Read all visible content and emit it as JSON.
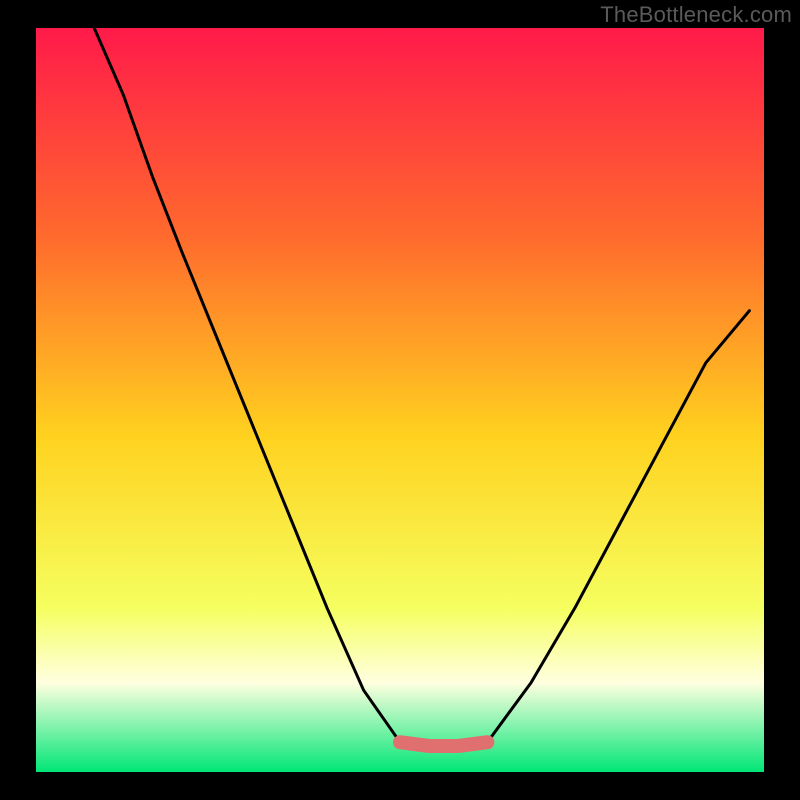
{
  "watermark": "TheBottleneck.com",
  "colors": {
    "background": "#000000",
    "gradient_top": "#ff1a4a",
    "gradient_upper_mid": "#ff6a2d",
    "gradient_mid": "#ffd21f",
    "gradient_lower_mid": "#f5ff60",
    "gradient_band_pale": "#ffffe0",
    "gradient_bottom": "#00e676",
    "curve_stroke": "#000000",
    "highlight_stroke": "#e06f6f",
    "watermark_text": "#5a5a5a"
  },
  "chart_data": {
    "type": "line",
    "title": "",
    "xlabel": "",
    "ylabel": "",
    "xlim": [
      0,
      100
    ],
    "ylim": [
      0,
      100
    ],
    "note": "No axes or tick labels are rendered; values are normalized 0–100 estimates of the curve geometry read from the figure.",
    "series": [
      {
        "name": "bottleneck-curve-left",
        "x": [
          8,
          12,
          16,
          20,
          25,
          30,
          35,
          40,
          45,
          50
        ],
        "values": [
          100,
          91,
          80,
          70,
          58,
          46,
          34,
          22,
          11,
          4
        ]
      },
      {
        "name": "bottleneck-curve-bottom",
        "x": [
          50,
          54,
          58,
          62
        ],
        "values": [
          4,
          3.5,
          3.5,
          4
        ]
      },
      {
        "name": "bottleneck-curve-right",
        "x": [
          62,
          68,
          74,
          80,
          86,
          92,
          98
        ],
        "values": [
          4,
          12,
          22,
          33,
          44,
          55,
          62
        ]
      },
      {
        "name": "highlight-segment",
        "x": [
          50,
          54,
          58,
          62
        ],
        "values": [
          4,
          3.5,
          3.5,
          4
        ]
      }
    ]
  }
}
